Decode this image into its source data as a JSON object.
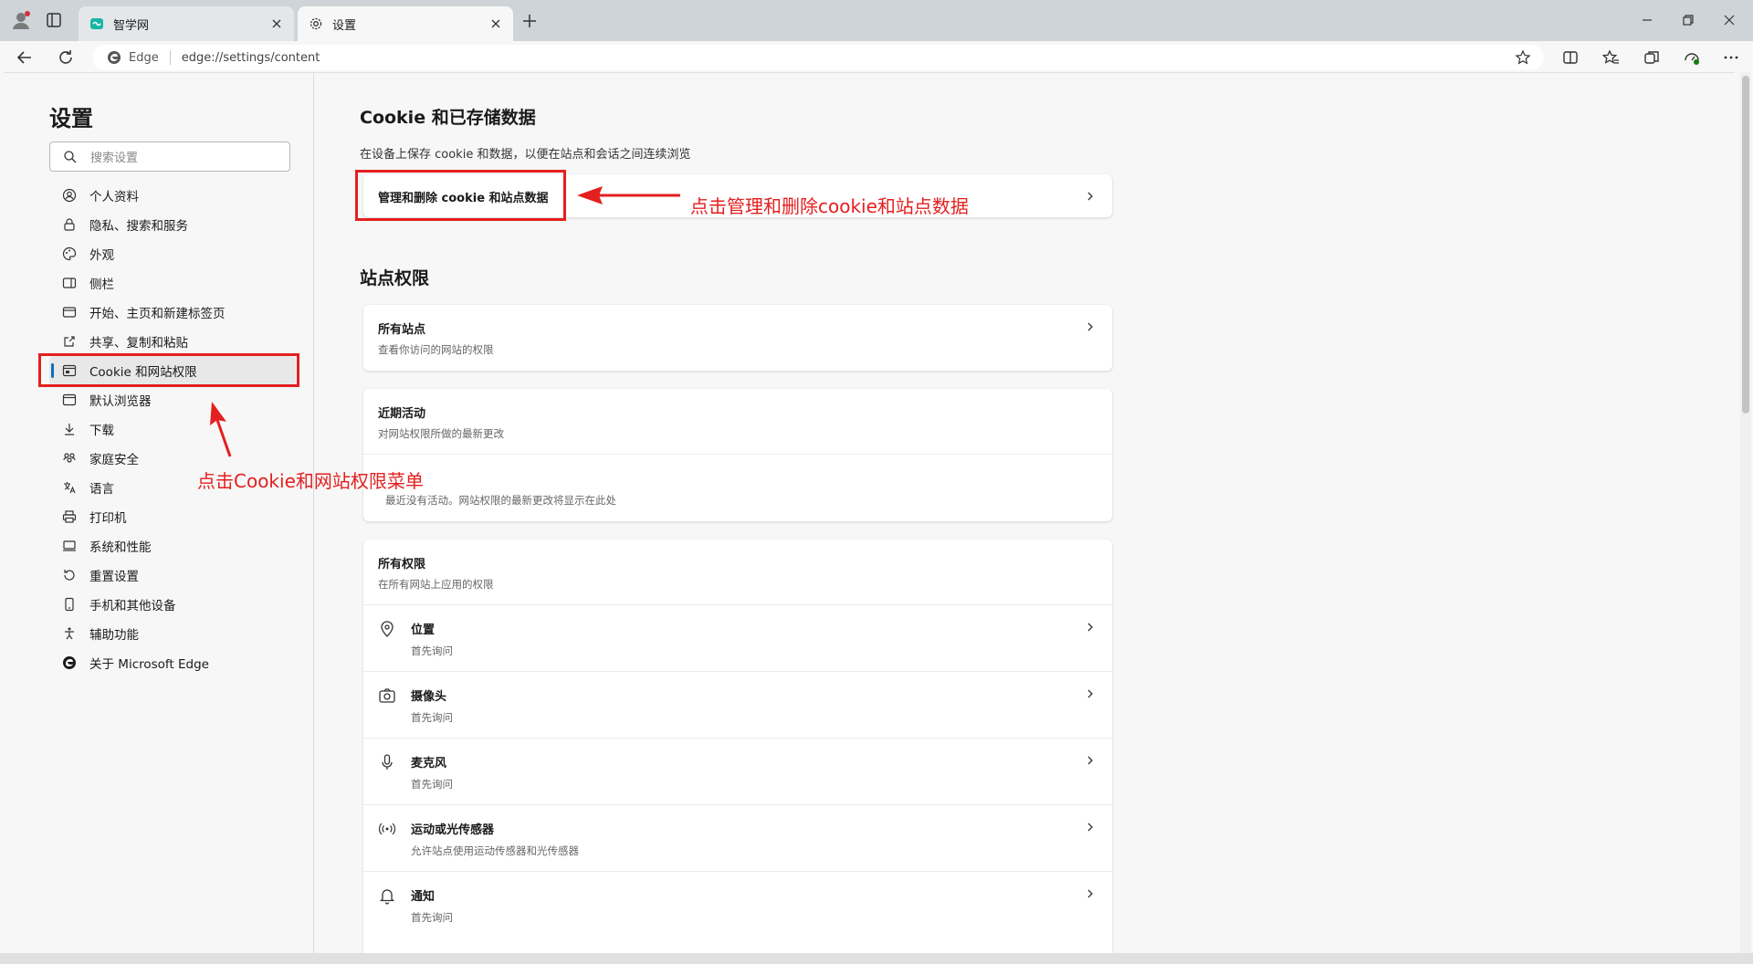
{
  "browser": {
    "tabs": [
      {
        "title": "智学网",
        "active": false
      },
      {
        "title": "设置",
        "active": true
      }
    ],
    "address": {
      "brand": "Edge",
      "url": "edge://settings/content"
    }
  },
  "sidebar": {
    "title": "设置",
    "search_placeholder": "搜索设置",
    "items": [
      {
        "label": "个人资料",
        "icon": "profile-icon"
      },
      {
        "label": "隐私、搜索和服务",
        "icon": "lock-icon"
      },
      {
        "label": "外观",
        "icon": "palette-icon"
      },
      {
        "label": "侧栏",
        "icon": "sidebar-icon"
      },
      {
        "label": "开始、主页和新建标签页",
        "icon": "home-tab-icon"
      },
      {
        "label": "共享、复制和粘贴",
        "icon": "share-icon"
      },
      {
        "label": "Cookie 和网站权限",
        "icon": "cookie-site-icon",
        "active": true
      },
      {
        "label": "默认浏览器",
        "icon": "browser-icon"
      },
      {
        "label": "下载",
        "icon": "download-icon"
      },
      {
        "label": "家庭安全",
        "icon": "family-icon"
      },
      {
        "label": "语言",
        "icon": "language-icon"
      },
      {
        "label": "打印机",
        "icon": "printer-icon"
      },
      {
        "label": "系统和性能",
        "icon": "system-icon"
      },
      {
        "label": "重置设置",
        "icon": "reset-icon"
      },
      {
        "label": "手机和其他设备",
        "icon": "phone-icon"
      },
      {
        "label": "辅助功能",
        "icon": "accessibility-icon"
      },
      {
        "label": "关于 Microsoft Edge",
        "icon": "edge-logo-icon"
      }
    ]
  },
  "content": {
    "cookie_section": {
      "title": "Cookie 和已存储数据",
      "desc": "在设备上保存 cookie 和数据，以便在站点和会话之间连续浏览",
      "manage_label": "管理和删除 cookie 和站点数据"
    },
    "site_perms": {
      "title": "站点权限",
      "all_sites": {
        "title": "所有站点",
        "sub": "查看你访问的网站的权限"
      },
      "recent": {
        "title": "近期活动",
        "sub": "对网站权限所做的最新更改",
        "empty": "最近没有活动。网站权限的最新更改将显示在此处"
      },
      "all_perms": {
        "title": "所有权限",
        "sub": "在所有网站上应用的权限"
      },
      "perms": [
        {
          "title": "位置",
          "sub": "首先询问",
          "icon": "location-icon"
        },
        {
          "title": "摄像头",
          "sub": "首先询问",
          "icon": "camera-icon"
        },
        {
          "title": "麦克风",
          "sub": "首先询问",
          "icon": "microphone-icon"
        },
        {
          "title": "运动或光传感器",
          "sub": "允许站点使用运动传感器和光传感器",
          "icon": "sensor-icon"
        },
        {
          "title": "通知",
          "sub": "首先询问",
          "icon": "bell-icon"
        }
      ]
    }
  },
  "annotations": {
    "manage_callout": "点击管理和删除cookie和站点数据",
    "menu_callout": "点击Cookie和网站权限菜单",
    "color": "#e41f1f"
  }
}
